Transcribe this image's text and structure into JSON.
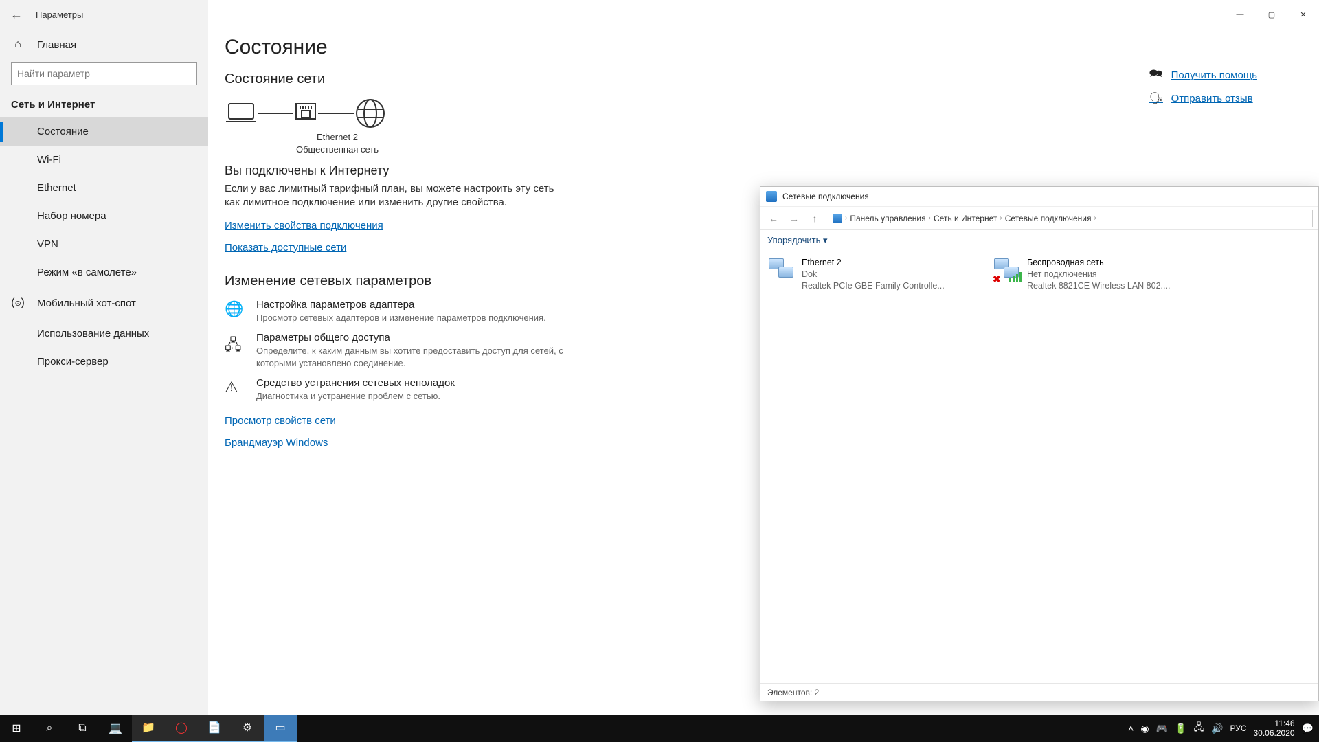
{
  "titlebar": {
    "back": "←",
    "app_title": "Параметры",
    "min": "—",
    "max": "▢",
    "close": "✕"
  },
  "sidebar": {
    "home": "Главная",
    "search_placeholder": "Найти параметр",
    "category": "Сеть и Интернет",
    "items": [
      {
        "icon": "",
        "label": "Состояние",
        "active": true
      },
      {
        "icon": "",
        "label": "Wi-Fi"
      },
      {
        "icon": "",
        "label": "Ethernet"
      },
      {
        "icon": "",
        "label": "Набор номера"
      },
      {
        "icon": "",
        "label": "VPN"
      },
      {
        "icon": "",
        "label": "Режим «в самолете»"
      },
      {
        "icon": "(ဓ)",
        "label": "Мобильный хот-спот"
      },
      {
        "icon": "",
        "label": "Использование данных"
      },
      {
        "icon": "",
        "label": "Прокси-сервер"
      }
    ]
  },
  "page": {
    "title": "Состояние",
    "net_status_h": "Состояние сети",
    "eth_name": "Ethernet 2",
    "eth_kind": "Общественная сеть",
    "connected_h": "Вы подключены к Интернету",
    "connected_body": "Если у вас лимитный тарифный план, вы можете настроить эту сеть как лимитное подключение или изменить другие свойства.",
    "link_props": "Изменить свойства подключения",
    "link_nets": "Показать доступные сети",
    "change_h": "Изменение сетевых параметров",
    "opt1_t": "Настройка параметров адаптера",
    "opt1_s": "Просмотр сетевых адаптеров и изменение параметров подключения.",
    "opt2_t": "Параметры общего доступа",
    "opt2_s": "Определите, к каким данным вы хотите предоставить доступ для сетей, с которыми установлено соединение.",
    "opt3_t": "Средство устранения сетевых неполадок",
    "opt3_s": "Диагностика и устранение проблем с сетью.",
    "link_netprops": "Просмотр свойств сети",
    "link_firewall": "Брандмауэр Windows"
  },
  "rightlinks": {
    "help": "Получить помощь",
    "feedback": "Отправить отзыв"
  },
  "explorer": {
    "title": "Сетевые подключения",
    "crumbs": [
      "Панель управления",
      "Сеть и Интернет",
      "Сетевые подключения"
    ],
    "toolbar": "Упорядочить ▾",
    "items": [
      {
        "name": "Ethernet 2",
        "sub1": "Dok",
        "sub2": "Realtek PCIe GBE Family Controlle..."
      },
      {
        "name": "Беспроводная сеть",
        "sub1": "Нет подключения",
        "sub2": "Realtek 8821CE Wireless LAN 802...."
      }
    ],
    "status": "Элементов: 2"
  },
  "taskbar": {
    "lang": "РУС",
    "time": "11:46",
    "date": "30.06.2020"
  }
}
